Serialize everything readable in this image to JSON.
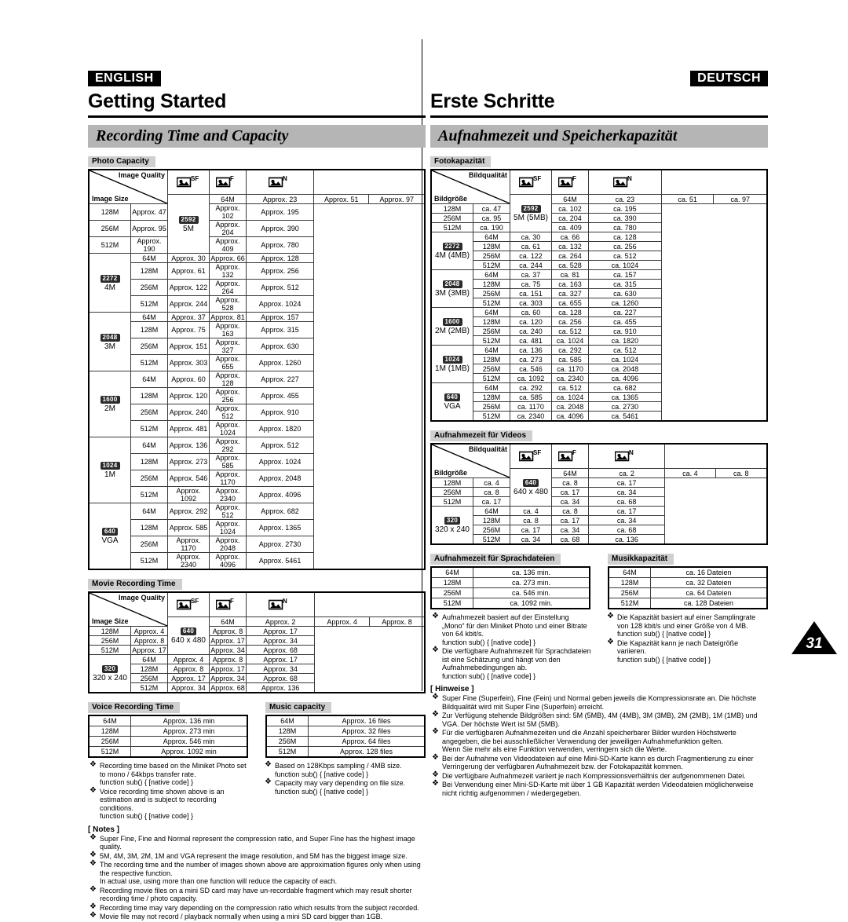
{
  "page": {
    "number": "31"
  },
  "english": {
    "lang_tag": "ENGLISH",
    "chapter_title": "Getting Started",
    "section_title": "Recording Time and Capacity",
    "photo": {
      "caption": "Photo Capacity",
      "header_quality": "Image Quality",
      "header_size": "Image Size",
      "quality_columns": [
        "SF",
        "F",
        "N"
      ],
      "memory_labels": [
        "64M",
        "128M",
        "256M",
        "512M"
      ],
      "groups": [
        {
          "badge": "2592",
          "label": "5M",
          "rows": [
            [
              "Approx. 23",
              "Approx. 51",
              "Approx. 97"
            ],
            [
              "Approx. 47",
              "Approx. 102",
              "Approx. 195"
            ],
            [
              "Approx. 95",
              "Approx. 204",
              "Approx. 390"
            ],
            [
              "Approx. 190",
              "Approx. 409",
              "Approx. 780"
            ]
          ]
        },
        {
          "badge": "2272",
          "label": "4M",
          "rows": [
            [
              "Approx. 30",
              "Approx. 66",
              "Approx. 128"
            ],
            [
              "Approx. 61",
              "Approx. 132",
              "Approx. 256"
            ],
            [
              "Approx. 122",
              "Approx. 264",
              "Approx. 512"
            ],
            [
              "Approx. 244",
              "Approx. 528",
              "Approx. 1024"
            ]
          ]
        },
        {
          "badge": "2048",
          "label": "3M",
          "rows": [
            [
              "Approx. 37",
              "Approx. 81",
              "Approx. 157"
            ],
            [
              "Approx. 75",
              "Approx. 163",
              "Approx. 315"
            ],
            [
              "Approx. 151",
              "Approx. 327",
              "Approx. 630"
            ],
            [
              "Approx. 303",
              "Approx. 655",
              "Approx. 1260"
            ]
          ]
        },
        {
          "badge": "1600",
          "label": "2M",
          "rows": [
            [
              "Approx. 60",
              "Approx. 128",
              "Approx. 227"
            ],
            [
              "Approx. 120",
              "Approx. 256",
              "Approx. 455"
            ],
            [
              "Approx. 240",
              "Approx. 512",
              "Approx. 910"
            ],
            [
              "Approx. 481",
              "Approx. 1024",
              "Approx. 1820"
            ]
          ]
        },
        {
          "badge": "1024",
          "label": "1M",
          "rows": [
            [
              "Approx. 136",
              "Approx. 292",
              "Approx. 512"
            ],
            [
              "Approx. 273",
              "Approx. 585",
              "Approx. 1024"
            ],
            [
              "Approx. 546",
              "Approx. 1170",
              "Approx. 2048"
            ],
            [
              "Approx. 1092",
              "Approx. 2340",
              "Approx. 4096"
            ]
          ]
        },
        {
          "badge": "640",
          "label": "VGA",
          "rows": [
            [
              "Approx. 292",
              "Approx. 512",
              "Approx. 682"
            ],
            [
              "Approx. 585",
              "Approx. 1024",
              "Approx. 1365"
            ],
            [
              "Approx. 1170",
              "Approx. 2048",
              "Approx. 2730"
            ],
            [
              "Approx. 2340",
              "Approx. 4096",
              "Approx. 5461"
            ]
          ]
        }
      ]
    },
    "movie": {
      "caption": "Movie Recording Time",
      "header_quality": "Image Quality",
      "header_size": "Image Size",
      "quality_columns": [
        "SF",
        "F",
        "N"
      ],
      "memory_labels": [
        "64M",
        "128M",
        "256M",
        "512M"
      ],
      "groups": [
        {
          "badge": "640",
          "label": "640 x 480",
          "rows": [
            [
              "Approx. 2",
              "Approx. 4",
              "Approx. 8"
            ],
            [
              "Approx. 4",
              "Approx. 8",
              "Approx. 17"
            ],
            [
              "Approx. 8",
              "Approx. 17",
              "Approx. 34"
            ],
            [
              "Approx. 17",
              "Approx. 34",
              "Approx. 68"
            ]
          ]
        },
        {
          "badge": "320",
          "label": "320 x 240",
          "rows": [
            [
              "Approx. 4",
              "Approx. 8",
              "Approx. 17"
            ],
            [
              "Approx. 8",
              "Approx. 17",
              "Approx. 34"
            ],
            [
              "Approx. 17",
              "Approx. 34",
              "Approx. 68"
            ],
            [
              "Approx. 34",
              "Approx. 68",
              "Approx. 136"
            ]
          ]
        }
      ]
    },
    "voice": {
      "caption": "Voice Recording Time",
      "rows": [
        [
          "64M",
          "Approx. 136 min"
        ],
        [
          "128M",
          "Approx. 273 min"
        ],
        [
          "256M",
          "Approx. 546 min"
        ],
        [
          "512M",
          "Approx. 1092 min"
        ]
      ]
    },
    "music": {
      "caption": "Music capacity",
      "rows": [
        [
          "64M",
          "Approx. 16 files"
        ],
        [
          "128M",
          "Approx. 32 files"
        ],
        [
          "256M",
          "Approx. 64 files"
        ],
        [
          "512M",
          "Approx. 128 files"
        ]
      ]
    },
    "voice_notes": [
      "Recording time based on the Miniket Photo set to mono / 64kbps transfer rate.",
      "Voice recording time shown above is an estimation and is subject to recording conditions."
    ],
    "music_notes": [
      "Based on 128Kbps sampling / 4MB size.",
      "Capacity may vary depending on file size."
    ],
    "notes_heading": "[ Notes ]",
    "notes": [
      {
        "text": "Super Fine, Fine and Normal represent the compression ratio, and Super Fine has the highest image quality."
      },
      {
        "text": "5M, 4M, 3M, 2M, 1M and VGA represent the image resolution, and 5M has the biggest image size."
      },
      {
        "text": "The recording time and the number of images shown above are approximation figures only when using the respective function.",
        "sub": "In actual use, using more than one function will reduce the capacity of each."
      },
      {
        "text": "Recording movie files on a mini SD card may have un-recordable fragment which may result shorter recording time / photo capacity."
      },
      {
        "text": "Recording time may vary depending on the compression ratio which results from the subject recorded."
      },
      {
        "text": "Movie file may not record / playback normally when using a mini SD card bigger than 1GB."
      }
    ]
  },
  "german": {
    "lang_tag": "DEUTSCH",
    "chapter_title": "Erste Schritte",
    "section_title": "Aufnahmezeit und Speicherkapazität",
    "photo": {
      "caption": "Fotokapazität",
      "header_quality": "Bildqualität",
      "header_size": "Bildgröße",
      "quality_columns": [
        "SF",
        "F",
        "N"
      ],
      "memory_labels": [
        "64M",
        "128M",
        "256M",
        "512M"
      ],
      "groups": [
        {
          "badge": "2592",
          "label": "5M (5MB)",
          "rows": [
            [
              "ca. 23",
              "ca. 51",
              "ca. 97"
            ],
            [
              "ca. 47",
              "ca. 102",
              "ca. 195"
            ],
            [
              "ca. 95",
              "ca. 204",
              "ca. 390"
            ],
            [
              "ca. 190",
              "ca. 409",
              "ca. 780"
            ]
          ]
        },
        {
          "badge": "2272",
          "label": "4M (4MB)",
          "rows": [
            [
              "ca. 30",
              "ca. 66",
              "ca. 128"
            ],
            [
              "ca. 61",
              "ca. 132",
              "ca. 256"
            ],
            [
              "ca. 122",
              "ca. 264",
              "ca. 512"
            ],
            [
              "ca. 244",
              "ca. 528",
              "ca. 1024"
            ]
          ]
        },
        {
          "badge": "2048",
          "label": "3M (3MB)",
          "rows": [
            [
              "ca. 37",
              "ca. 81",
              "ca. 157"
            ],
            [
              "ca. 75",
              "ca. 163",
              "ca. 315"
            ],
            [
              "ca. 151",
              "ca. 327",
              "ca. 630"
            ],
            [
              "ca. 303",
              "ca. 655",
              "ca. 1260"
            ]
          ]
        },
        {
          "badge": "1600",
          "label": "2M (2MB)",
          "rows": [
            [
              "ca. 60",
              "ca. 128",
              "ca. 227"
            ],
            [
              "ca. 120",
              "ca. 256",
              "ca. 455"
            ],
            [
              "ca. 240",
              "ca. 512",
              "ca. 910"
            ],
            [
              "ca. 481",
              "ca. 1024",
              "ca. 1820"
            ]
          ]
        },
        {
          "badge": "1024",
          "label": "1M (1MB)",
          "rows": [
            [
              "ca. 136",
              "ca. 292",
              "ca. 512"
            ],
            [
              "ca. 273",
              "ca. 585",
              "ca. 1024"
            ],
            [
              "ca. 546",
              "ca. 1170",
              "ca. 2048"
            ],
            [
              "ca. 1092",
              "ca. 2340",
              "ca. 4096"
            ]
          ]
        },
        {
          "badge": "640",
          "label": "VGA",
          "rows": [
            [
              "ca. 292",
              "ca. 512",
              "ca. 682"
            ],
            [
              "ca. 585",
              "ca. 1024",
              "ca. 1365"
            ],
            [
              "ca. 1170",
              "ca. 2048",
              "ca. 2730"
            ],
            [
              "ca. 2340",
              "ca. 4096",
              "ca. 5461"
            ]
          ]
        }
      ]
    },
    "movie": {
      "caption": "Aufnahmezeit für Videos",
      "header_quality": "Bildqualität",
      "header_size": "Bildgröße",
      "quality_columns": [
        "SF",
        "F",
        "N"
      ],
      "memory_labels": [
        "64M",
        "128M",
        "256M",
        "512M"
      ],
      "groups": [
        {
          "badge": "640",
          "label": "640 x 480",
          "rows": [
            [
              "ca. 2",
              "ca. 4",
              "ca. 8"
            ],
            [
              "ca. 4",
              "ca. 8",
              "ca. 17"
            ],
            [
              "ca. 8",
              "ca. 17",
              "ca. 34"
            ],
            [
              "ca. 17",
              "ca. 34",
              "ca. 68"
            ]
          ]
        },
        {
          "badge": "320",
          "label": "320 x 240",
          "rows": [
            [
              "ca. 4",
              "ca. 8",
              "ca. 17"
            ],
            [
              "ca. 8",
              "ca. 17",
              "ca. 34"
            ],
            [
              "ca. 17",
              "ca. 34",
              "ca. 68"
            ],
            [
              "ca. 34",
              "ca. 68",
              "ca. 136"
            ]
          ]
        }
      ]
    },
    "voice": {
      "caption": "Aufnahmezeit für Sprachdateien",
      "rows": [
        [
          "64M",
          "ca. 136 min."
        ],
        [
          "128M",
          "ca. 273 min."
        ],
        [
          "256M",
          "ca. 546 min."
        ],
        [
          "512M",
          "ca. 1092 min."
        ]
      ]
    },
    "music": {
      "caption": "Musikkapazität",
      "rows": [
        [
          "64M",
          "ca. 16 Dateien"
        ],
        [
          "128M",
          "ca. 32 Dateien"
        ],
        [
          "256M",
          "ca. 64 Dateien"
        ],
        [
          "512M",
          "ca. 128 Dateien"
        ]
      ]
    },
    "voice_notes": [
      "Aufnahmezeit basiert auf der Einstellung „Mono“ für den Miniket Photo und einer Bitrate von 64 kbit/s.",
      "Die verfügbare Aufnahmezeit für Sprachdateien ist eine Schätzung und hängt von den Aufnahmebedingungen ab."
    ],
    "music_notes": [
      "Die Kapazität basiert auf einer Samplingrate von 128 kbit/s und einer Größe von 4 MB.",
      "Die Kapazität kann je nach Dateigröße variieren."
    ],
    "notes_heading": "[ Hinweise ]",
    "notes": [
      {
        "text": "Super Fine (Superfein), Fine (Fein) und Normal geben jeweils die Kompressionsrate an. Die höchste Bildqualität wird mit Super Fine (Superfein) erreicht."
      },
      {
        "text": "Zur Verfügung stehende Bildgrößen sind: 5M (5MB), 4M (4MB), 3M (3MB), 2M (2MB), 1M (1MB) und VGA. Der höchste Wert ist 5M (5MB)."
      },
      {
        "text": "Für die verfügbaren Aufnahmezeiten und die Anzahl speicherbarer Bilder wurden Höchstwerte angegeben, die bei ausschließlicher Verwendung der jeweiligen Aufnahmefunktion gelten.",
        "sub": "Wenn Sie mehr als eine Funktion verwenden, verringern sich die Werte."
      },
      {
        "text": "Bei der Aufnahme von Videodateien auf eine Mini-SD-Karte kann es durch Fragmentierung zu einer Verringerung der verfügbaren Aufnahmezeit bzw. der Fotokapazität kommen."
      },
      {
        "text": "Die verfügbare Aufnahmezeit variiert je nach Kompressionsverhältnis der aufgenommenen Datei."
      },
      {
        "text": "Bei Verwendung einer Mini-SD-Karte mit über 1 GB Kapazität werden Videodateien möglicherweise nicht richtig aufgenommen / wiedergegeben."
      }
    ]
  }
}
